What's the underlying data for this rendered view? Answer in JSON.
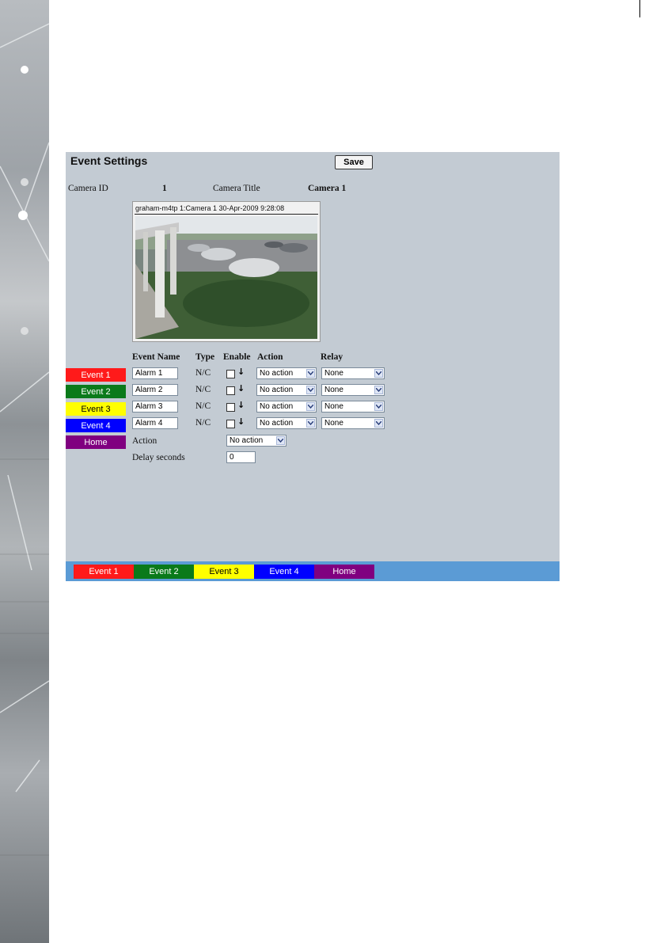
{
  "panel": {
    "title": "Event Settings",
    "save_label": "Save",
    "camera_id_label": "Camera ID",
    "camera_id_value": "1",
    "camera_title_label": "Camera Title",
    "camera_title_value": "Camera 1"
  },
  "video": {
    "caption": "graham-m4tp 1:Camera 1 30-Apr-2009 9:28:08"
  },
  "table": {
    "headers": [
      "Event Name",
      "Type",
      "Enable",
      "Action",
      "Relay"
    ],
    "rows": [
      {
        "name": "Alarm 1",
        "type": "N/C",
        "action": "No action",
        "relay": "None"
      },
      {
        "name": "Alarm 2",
        "type": "N/C",
        "action": "No action",
        "relay": "None"
      },
      {
        "name": "Alarm 3",
        "type": "N/C",
        "action": "No action",
        "relay": "None"
      },
      {
        "name": "Alarm 4",
        "type": "N/C",
        "action": "No action",
        "relay": "None"
      }
    ]
  },
  "global": {
    "action_label": "Action",
    "action_value": "No action",
    "delay_label": "Delay seconds",
    "delay_value": "0"
  },
  "side_nav": [
    {
      "label": "Event 1",
      "bg": "#ff1a1a",
      "fg": "#ffffff"
    },
    {
      "label": "Event 2",
      "bg": "#0a7a1a",
      "fg": "#ffffff"
    },
    {
      "label": "Event 3",
      "bg": "#ffff00",
      "fg": "#000000"
    },
    {
      "label": "Event 4",
      "bg": "#0000ff",
      "fg": "#ffffff"
    },
    {
      "label": "Home",
      "bg": "#800080",
      "fg": "#ffffff"
    }
  ],
  "bottom_nav": [
    {
      "label": "Event 1",
      "bg": "#ff1a1a",
      "fg": "#ffffff"
    },
    {
      "label": "Event 2",
      "bg": "#0a7a1a",
      "fg": "#ffffff"
    },
    {
      "label": "Event 3",
      "bg": "#ffff00",
      "fg": "#000000"
    },
    {
      "label": "Event 4",
      "bg": "#0000ff",
      "fg": "#ffffff"
    },
    {
      "label": "Home",
      "bg": "#800080",
      "fg": "#ffffff"
    }
  ],
  "colors": {
    "panel_bg": "#c3cbd3",
    "bottom_bar": "#5b9bd5"
  },
  "icons": {
    "enable_marker": "down-arrow-icon",
    "dropdown": "chevron-down-icon"
  }
}
